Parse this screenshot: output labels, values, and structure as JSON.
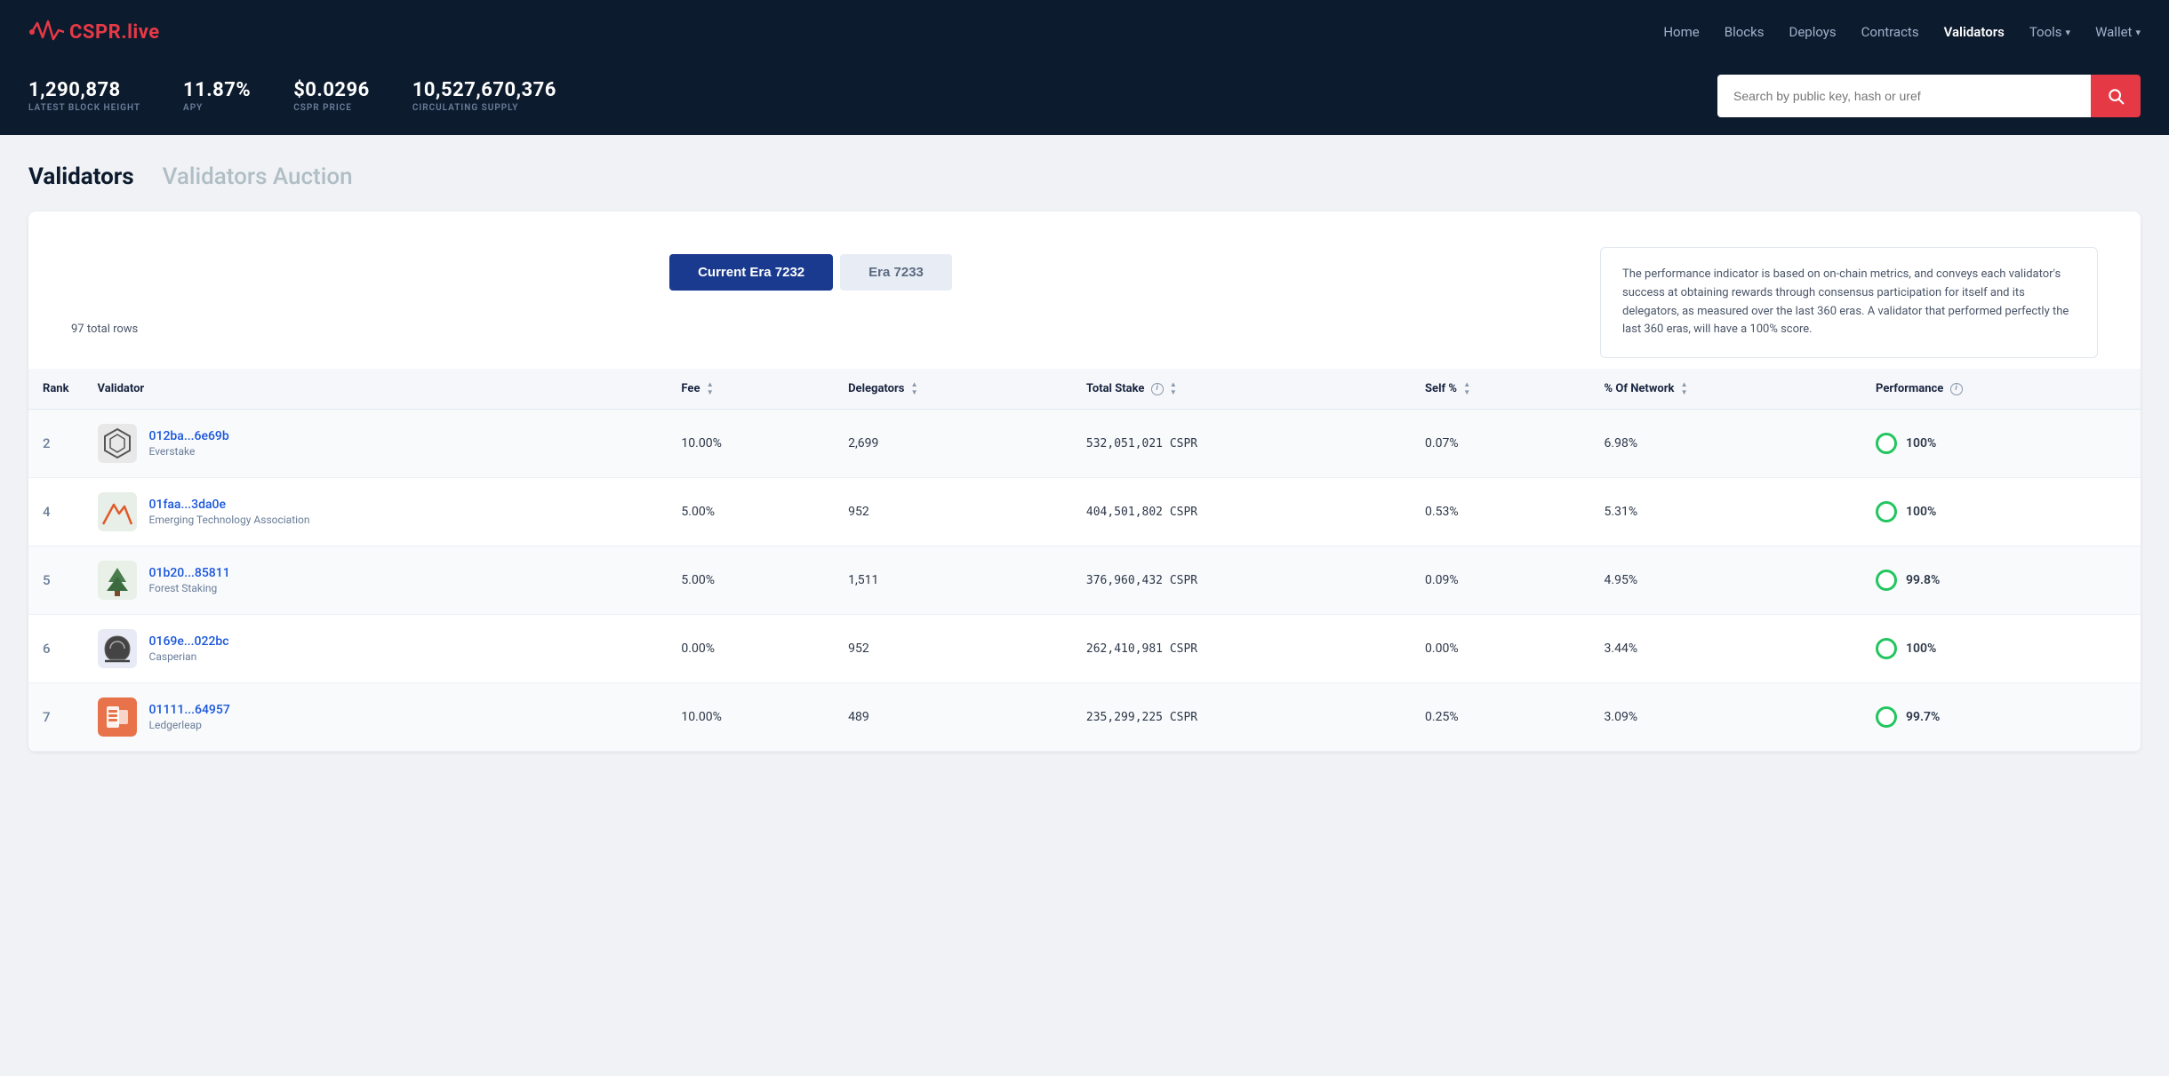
{
  "header": {
    "logo_text": "CSPR",
    "logo_suffix": ".live",
    "nav": [
      {
        "label": "Home",
        "active": false
      },
      {
        "label": "Blocks",
        "active": false
      },
      {
        "label": "Deploys",
        "active": false
      },
      {
        "label": "Contracts",
        "active": false
      },
      {
        "label": "Validators",
        "active": true
      },
      {
        "label": "Tools",
        "active": false,
        "has_dropdown": true
      },
      {
        "label": "Wallet",
        "active": false,
        "has_dropdown": true
      }
    ]
  },
  "stats": [
    {
      "value": "1,290,878",
      "label": "LATEST BLOCK HEIGHT"
    },
    {
      "value": "11.87%",
      "label": "APY"
    },
    {
      "value": "$0.0296",
      "label": "CSPR PRICE"
    },
    {
      "value": "10,527,670,376",
      "label": "CIRCULATING SUPPLY"
    }
  ],
  "search": {
    "placeholder": "Search by public key, hash or uref"
  },
  "page": {
    "title": "Validators",
    "tab_active": "Validators",
    "tab_inactive": "Validators Auction"
  },
  "era_selector": {
    "current_era_label": "Current Era 7232",
    "next_era_label": "Era 7233"
  },
  "info_text": "The performance indicator is based on on-chain metrics, and conveys each validator's success at obtaining rewards through consensus participation for itself and its delegators, as measured over the last 360 eras. A validator that performed perfectly the last 360 eras, will have a 100% score.",
  "table": {
    "total_rows": "97 total rows",
    "columns": [
      {
        "label": "Rank",
        "sortable": false
      },
      {
        "label": "Validator",
        "sortable": false
      },
      {
        "label": "Fee",
        "sortable": true
      },
      {
        "label": "Delegators",
        "sortable": true
      },
      {
        "label": "Total Stake",
        "sortable": true,
        "info": true
      },
      {
        "label": "Self %",
        "sortable": true
      },
      {
        "label": "% Of Network",
        "sortable": true
      },
      {
        "label": "Performance",
        "sortable": false,
        "info": true
      }
    ],
    "rows": [
      {
        "rank": "2",
        "address": "012ba...6e69b",
        "name": "Everstake",
        "fee": "10.00%",
        "delegators": "2,699",
        "total_stake": "532,051,021 CSPR",
        "self_pct": "0.07%",
        "network_pct": "6.98%",
        "performance": "100%",
        "icon_type": "hexagon"
      },
      {
        "rank": "4",
        "address": "01faa...3da0e",
        "name": "Emerging Technology Association",
        "fee": "5.00%",
        "delegators": "952",
        "total_stake": "404,501,802 CSPR",
        "self_pct": "0.53%",
        "network_pct": "5.31%",
        "performance": "100%",
        "icon_type": "mountain"
      },
      {
        "rank": "5",
        "address": "01b20...85811",
        "name": "Forest Staking",
        "fee": "5.00%",
        "delegators": "1,511",
        "total_stake": "376,960,432 CSPR",
        "self_pct": "0.09%",
        "network_pct": "4.95%",
        "performance": "99.8%",
        "icon_type": "forest"
      },
      {
        "rank": "6",
        "address": "0169e...022bc",
        "name": "Casperian",
        "fee": "0.00%",
        "delegators": "952",
        "total_stake": "262,410,981 CSPR",
        "self_pct": "0.00%",
        "network_pct": "3.44%",
        "performance": "100%",
        "icon_type": "helmet"
      },
      {
        "rank": "7",
        "address": "01111...64957",
        "name": "Ledgerleap",
        "fee": "10.00%",
        "delegators": "489",
        "total_stake": "235,299,225 CSPR",
        "self_pct": "0.25%",
        "network_pct": "3.09%",
        "performance": "99.7%",
        "icon_type": "ledger"
      }
    ]
  }
}
